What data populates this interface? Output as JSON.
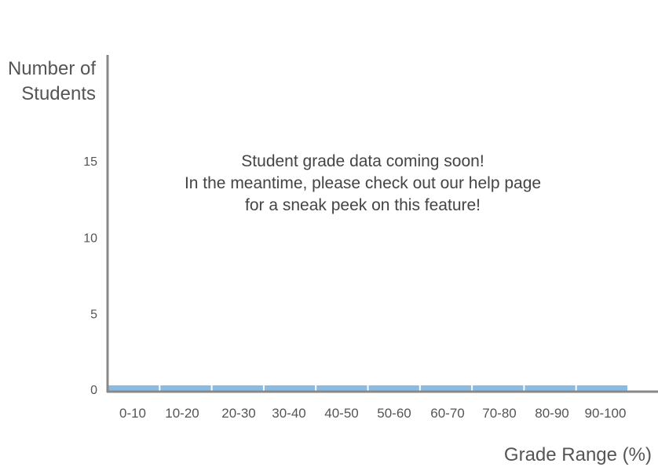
{
  "chart_data": {
    "type": "bar",
    "title": "",
    "ylabel_lines": [
      "Number of",
      "Students"
    ],
    "xlabel": "Grade Range (%)",
    "categories": [
      "0-10",
      "10-20",
      "20-30",
      "30-40",
      "40-50",
      "50-60",
      "60-70",
      "70-80",
      "80-90",
      "90-100"
    ],
    "values": [
      0,
      0,
      0,
      0,
      0,
      0,
      0,
      0,
      0,
      0
    ],
    "ylim": [
      0,
      20
    ],
    "yticks": [
      0,
      5,
      10,
      15
    ],
    "grid": false,
    "bar_color": "#8bbbe0",
    "axis_color": "#888888",
    "message_lines": [
      "Student grade data coming soon!",
      "In the meantime, please check out our help page",
      "for a sneak peek on this feature!"
    ]
  }
}
